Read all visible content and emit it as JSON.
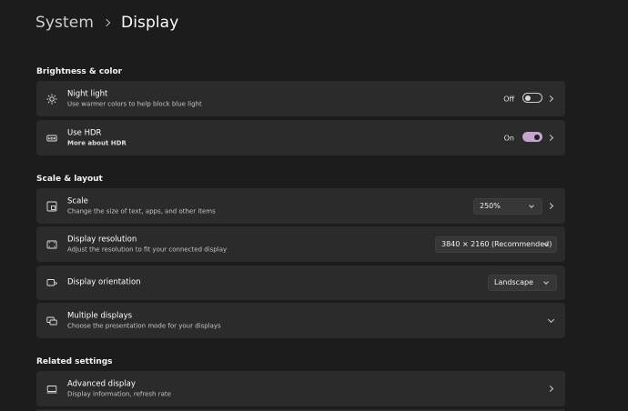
{
  "breadcrumb": {
    "parent": "System",
    "current": "Display"
  },
  "sections": {
    "brightness": "Brightness & color",
    "scale": "Scale & layout",
    "related": "Related settings"
  },
  "night_light": {
    "title": "Night light",
    "desc": "Use warmer colors to help block blue light",
    "state": "Off",
    "icon": "sun-icon"
  },
  "hdr": {
    "title": "Use HDR",
    "link": "More about HDR",
    "state": "On",
    "icon": "hdr-icon",
    "accent": "#c7a3cf"
  },
  "scale_row": {
    "title": "Scale",
    "desc": "Change the size of text, apps, and other items",
    "value": "250%",
    "icon": "scale-icon"
  },
  "resolution": {
    "title": "Display resolution",
    "desc": "Adjust the resolution to fit your connected display",
    "value": "3840 × 2160 (Recommended)",
    "icon": "resolution-icon"
  },
  "orientation": {
    "title": "Display orientation",
    "value": "Landscape",
    "icon": "orientation-icon"
  },
  "multiple": {
    "title": "Multiple displays",
    "desc": "Choose the presentation mode for your displays",
    "icon": "multiple-displays-icon"
  },
  "advanced": {
    "title": "Advanced display",
    "desc": "Display information, refresh rate",
    "icon": "monitor-icon"
  }
}
